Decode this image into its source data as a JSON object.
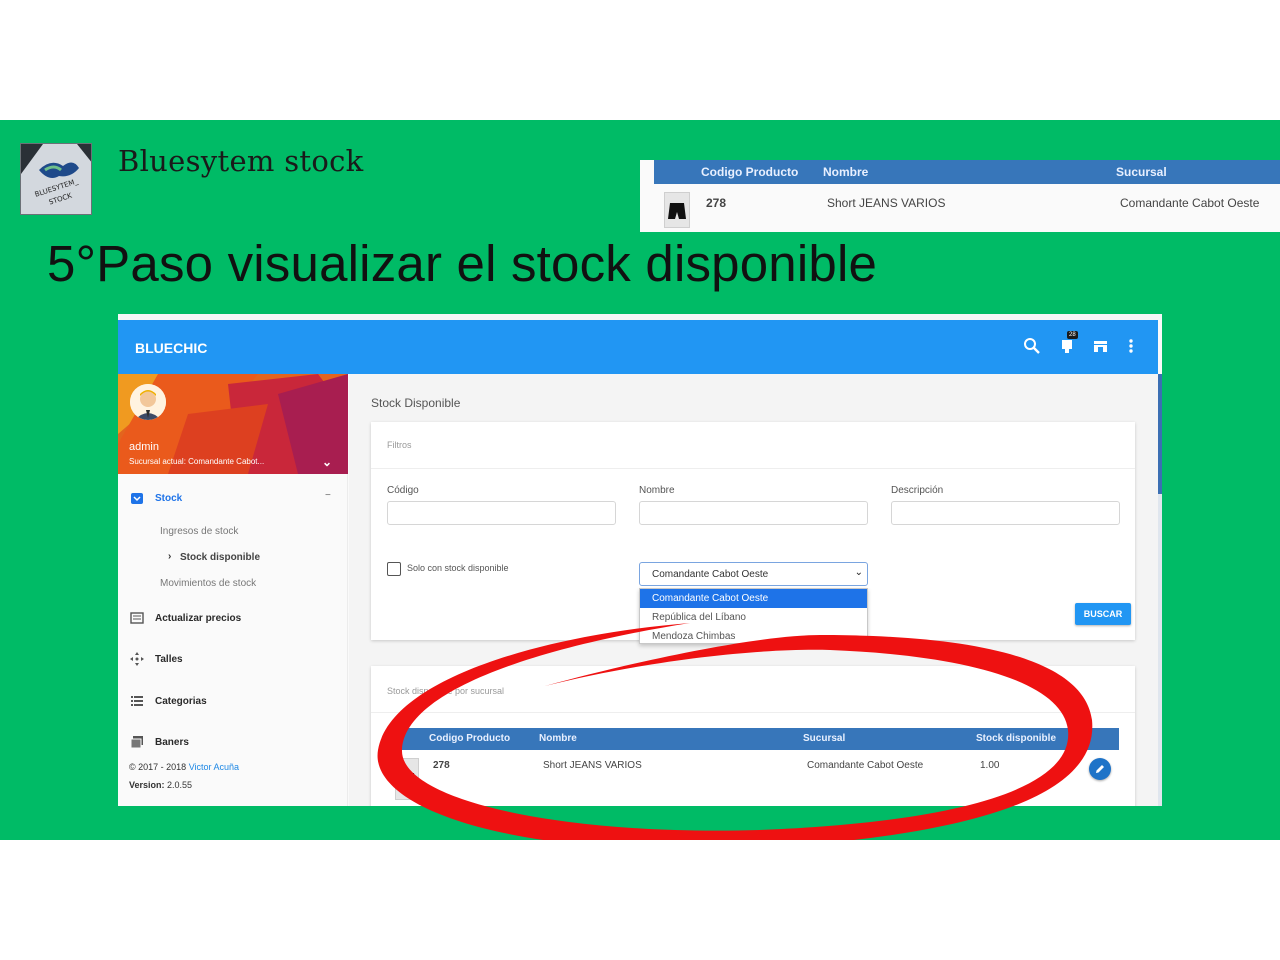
{
  "brand": {
    "name": "Bluesytem stock",
    "logo_text": "BLUESYTEM STOCK"
  },
  "headline": "5°Paso visualizar el stock disponible",
  "zoom": {
    "headers": [
      "Codigo Producto",
      "Nombre",
      "Sucursal"
    ],
    "row": {
      "code": "278",
      "name": "Short JEANS VARIOS",
      "branch": "Comandante Cabot Oeste"
    }
  },
  "app": {
    "title": "BLUECHIC",
    "notification_count": "28",
    "toolbar_icons": [
      "search-icon",
      "notification-icon",
      "store-icon",
      "more-vert-icon"
    ],
    "profile": {
      "user": "admin",
      "branch_line": "Sucursal actual: Comandante Cabot..."
    },
    "nav": {
      "stock": "Stock",
      "stock_collapse": "−",
      "ingresos": "Ingresos de stock",
      "disponible_chevron": "›",
      "disponible": "Stock disponible",
      "movimientos": "Movimientos de stock",
      "precios": "Actualizar precios",
      "talles": "Talles",
      "categorias": "Categorias",
      "baners": "Baners"
    },
    "footer": {
      "copyright": "© 2017 - 2018 ",
      "author": "Victor Acuña",
      "version_label": "Version:",
      "version": " 2.0.55"
    },
    "page_title": "Stock Disponible",
    "filters": {
      "title": "Filtros",
      "codigo_label": "Código",
      "nombre_label": "Nombre",
      "descripcion_label": "Descripción",
      "checkbox_label": "Solo con stock disponible",
      "checkbox_checked": false,
      "branch_selected": "Comandante Cabot Oeste",
      "branch_options": [
        "Comandante Cabot Oeste",
        "República del Líbano",
        "Mendoza Chimbas"
      ],
      "search_button": "BUSCAR"
    },
    "results": {
      "title": "Stock disponible por sucursal",
      "headers": [
        "Codigo Producto",
        "Nombre",
        "Sucursal",
        "Stock disponible"
      ],
      "rows": [
        {
          "code": "278",
          "name": "Short JEANS VARIOS",
          "branch": "Comandante Cabot Oeste",
          "stock": "1.00"
        }
      ]
    }
  },
  "colors": {
    "banner": "#00bb66",
    "app_bar": "#2196f3",
    "table_header": "#3776ba",
    "annotation": "#ee1111"
  }
}
